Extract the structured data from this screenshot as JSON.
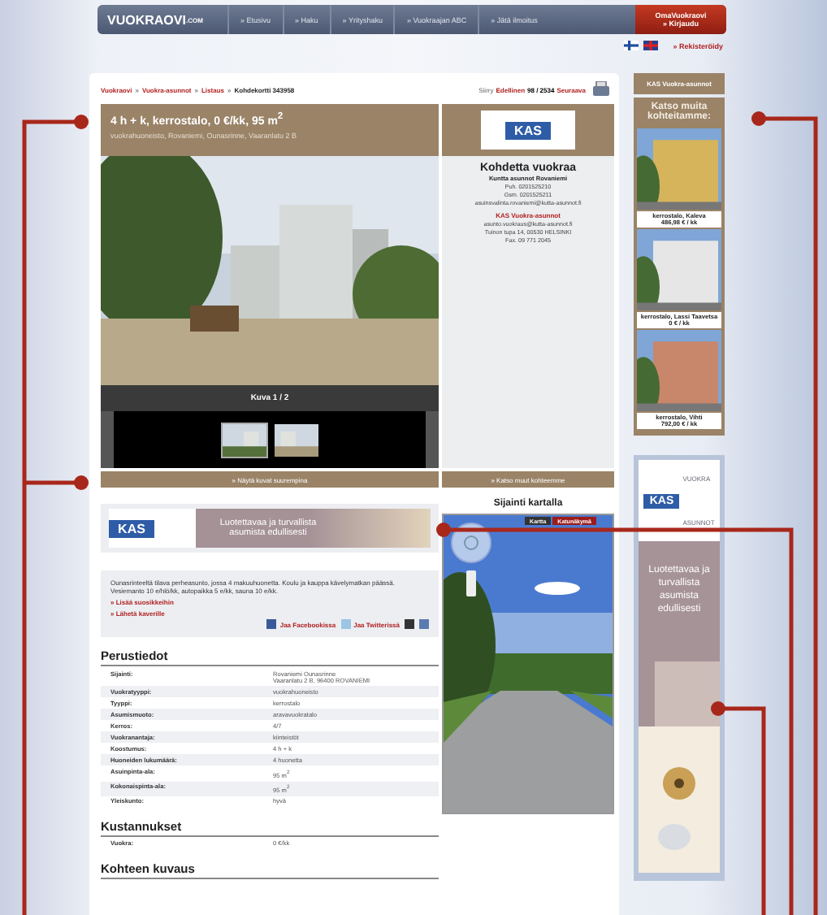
{
  "nav": {
    "logo": "VUOKRAOVI",
    "logo_suffix": ".COM",
    "items": [
      "» Etusivu",
      "» Haku",
      "» Yrityshaku",
      "» Vuokraajan ABC",
      "» Jätä ilmoitus"
    ],
    "account": {
      "title": "OmaVuokraovi",
      "link": "» Kirjaudu"
    }
  },
  "register_link": "» Rekisteröidy",
  "breadcrumb": {
    "separator": "»",
    "items": [
      {
        "label": "Vuokraovi",
        "current": false
      },
      {
        "label": "Vuokra-asunnot",
        "current": false
      },
      {
        "label": "Listaus",
        "current": false
      },
      {
        "label": "Kohdekortti 343958",
        "current": true
      }
    ]
  },
  "pager": {
    "label": "Siirry",
    "prev": "Edellinen",
    "position": "98 / 2534",
    "next": "Seuraava"
  },
  "listing": {
    "title": "4 h + k, kerrostalo, 0 €/kk, 95 m$^{2}$",
    "subtitle": "vuokrahuoneisto, Rovaniemi, Ounasrinne, Vaaranlatu 2 B",
    "photo_caption": "Kuva 1 / 2",
    "thumbnails": [
      {
        "selected": true
      },
      {
        "selected": false
      }
    ],
    "more_photos": "» Näytä kuvat suurempina"
  },
  "contact": {
    "logo": "KAS",
    "title": "Kohdetta vuokraa",
    "company": "Kuntta asunnot Rovaniemi",
    "lines": [
      "Puh. 0201525210",
      "Gsm. 0201525211",
      "asuinsvalinta.rovaniemi@kutta-asunnot.fi"
    ],
    "agency": "KAS Vuokra-asunnot",
    "agency_lines": [
      "asunto.vuokraus@kutta-asunnot.fi",
      "Tuinon tupa 14, 00530 HELSINKI",
      "Fax. 09 771 2045"
    ],
    "more_link": "» Katso muut kohteemme"
  },
  "banner": {
    "logo": "KAS",
    "text": "Luotettavaa ja turvallista asumista edullisesti"
  },
  "description": {
    "text": "Ounasrinteeltä tilava perheasunto, jossa 4 makuuhuonetta. Koulu ja kauppa kävelymatkan päässä. Vesiemanto 10 e/hlö/kk, autopaikka 5 e/kk, sauna 10 e/kk.",
    "links": [
      "» Lisää suosikkeihin",
      "» Lähetä kaverille"
    ],
    "share": [
      {
        "kind": "facebook",
        "label": "Jaa Facebookissa"
      },
      {
        "kind": "twitter",
        "label": "Jaa Twitterissä"
      }
    ]
  },
  "sections": [
    {
      "title": "Perustiedot",
      "rows": [
        {
          "label": "Sijainti:",
          "value": "Rovaniemi Ounasrinne",
          "value_2": "Vaaranlatu 2 B, 96400 ROVANIEMI"
        },
        {
          "label": "Vuokratyyppi:",
          "value": "vuokrahuoneisto"
        },
        {
          "label": "Tyyppi:",
          "value": "kerrostalo"
        },
        {
          "label": "Asumismuoto:",
          "value": "aravavuokratalo"
        },
        {
          "label": "Kerros:",
          "value": "4/7"
        },
        {
          "label": "Vuokranantaja:",
          "value": "kiinteistöt"
        },
        {
          "label": "Koostumus:",
          "value": "4 h + k"
        },
        {
          "label": "Huoneiden lukumäärä:",
          "value": "4 huonetta"
        },
        {
          "label": "Asuinpinta-ala:",
          "value": "95 m$^{2}$"
        },
        {
          "label": "Kokonaispinta-ala:",
          "value": "95 m$^{2}$"
        },
        {
          "label": "Yleiskunto:",
          "value": "hyvä"
        }
      ]
    },
    {
      "title": "Kustannukset",
      "rows": [
        {
          "label": "Vuokra:",
          "value": "0 €/kk"
        }
      ]
    },
    {
      "title": "Kohteen kuvaus"
    }
  ],
  "map": {
    "title": "Sijainti kartalla",
    "tabs": [
      {
        "label": "Kartta",
        "selected": false
      },
      {
        "label": "Katunäkymä",
        "selected": true
      }
    ]
  },
  "sidebar": {
    "header": "KAS Vuokra-asunnot",
    "title": "Katso muita kohteitamme:",
    "items": [
      {
        "name": "kerrostalo, Kaleva",
        "price": "486,98 € / kk"
      },
      {
        "name": "kerrostalo, Lassi Taavetsa",
        "price": "0 € / kk"
      },
      {
        "name": "kerrostalo, Vihti",
        "price": "792,00 € / kk"
      }
    ]
  },
  "ad": {
    "logo": "KAS",
    "logo_top": "VUOKRA",
    "logo_bottom": "ASUNNOT",
    "text": "Luotettavaa ja turvallista asumista edullisesti"
  }
}
